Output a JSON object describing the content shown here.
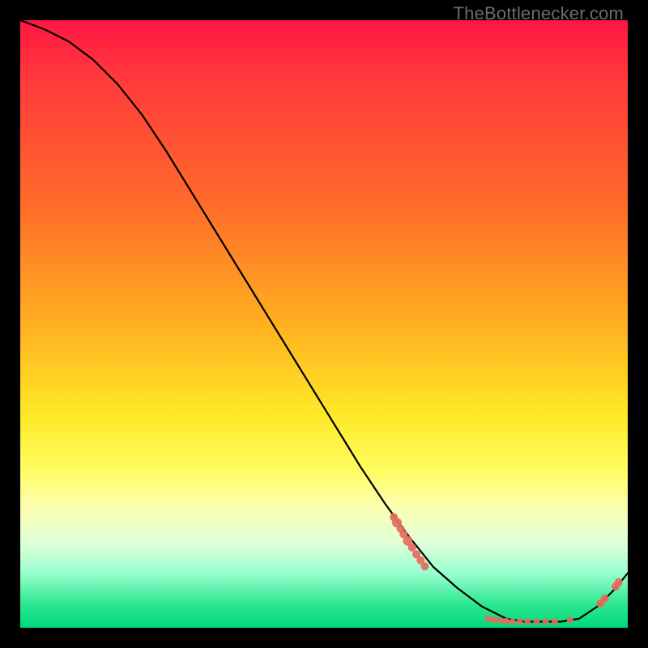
{
  "watermark": "TheBottlenecker.com",
  "chart_data": {
    "type": "line",
    "title": "",
    "xlabel": "",
    "ylabel": "",
    "xlim": [
      0,
      100
    ],
    "ylim": [
      0,
      100
    ],
    "grid": false,
    "legend": false,
    "series": [
      {
        "name": "curve",
        "stroke": "#000000",
        "x": [
          0,
          4,
          8,
          12,
          16,
          20,
          24,
          28,
          32,
          36,
          40,
          44,
          48,
          52,
          56,
          60,
          64,
          68,
          72,
          76,
          80,
          83,
          86,
          89,
          92,
          95,
          98,
          100
        ],
        "y": [
          100,
          98.5,
          96.5,
          93.5,
          89.5,
          84.5,
          78.5,
          72.0,
          65.5,
          59.0,
          52.5,
          46.0,
          39.5,
          33.0,
          26.5,
          20.5,
          15.0,
          10.0,
          6.5,
          3.5,
          1.5,
          1.0,
          1.0,
          1.0,
          1.5,
          3.5,
          6.5,
          9.0
        ]
      }
    ],
    "markers": [
      {
        "x": 61.5,
        "y": 18.2,
        "r": 5
      },
      {
        "x": 62.0,
        "y": 17.3,
        "r": 6
      },
      {
        "x": 62.6,
        "y": 16.3,
        "r": 5
      },
      {
        "x": 63.1,
        "y": 15.4,
        "r": 5
      },
      {
        "x": 63.8,
        "y": 14.3,
        "r": 6
      },
      {
        "x": 64.5,
        "y": 13.2,
        "r": 5
      },
      {
        "x": 65.2,
        "y": 12.1,
        "r": 5
      },
      {
        "x": 65.9,
        "y": 11.1,
        "r": 5
      },
      {
        "x": 66.6,
        "y": 10.1,
        "r": 5
      },
      {
        "x": 77.0,
        "y": 1.5,
        "r": 4
      },
      {
        "x": 78.0,
        "y": 1.3,
        "r": 4
      },
      {
        "x": 79.0,
        "y": 1.2,
        "r": 4
      },
      {
        "x": 80.0,
        "y": 1.1,
        "r": 4
      },
      {
        "x": 81.0,
        "y": 1.0,
        "r": 4
      },
      {
        "x": 82.2,
        "y": 1.0,
        "r": 4
      },
      {
        "x": 83.5,
        "y": 1.0,
        "r": 4
      },
      {
        "x": 85.0,
        "y": 1.0,
        "r": 4
      },
      {
        "x": 86.5,
        "y": 1.0,
        "r": 4
      },
      {
        "x": 88.0,
        "y": 1.0,
        "r": 4
      },
      {
        "x": 90.5,
        "y": 1.3,
        "r": 4
      },
      {
        "x": 95.5,
        "y": 4.0,
        "r": 5
      },
      {
        "x": 96.2,
        "y": 4.8,
        "r": 5
      },
      {
        "x": 98.0,
        "y": 6.8,
        "r": 5
      },
      {
        "x": 98.5,
        "y": 7.5,
        "r": 5
      }
    ],
    "marker_fill": "#e66a5c",
    "marker_stroke": "#e66a5c"
  }
}
